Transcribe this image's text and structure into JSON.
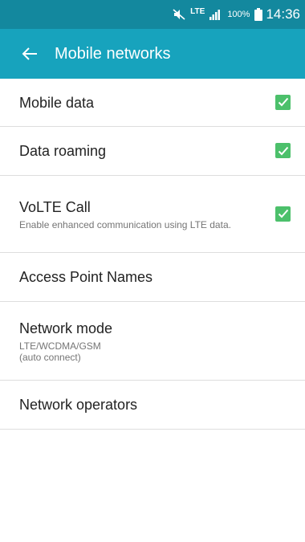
{
  "status_bar": {
    "icons": [
      "mute-icon",
      "lte-icon",
      "signal-icon",
      "battery-icon"
    ],
    "lte_label": "LTE",
    "battery_percent": "100%",
    "time": "14:36"
  },
  "app_bar": {
    "back_icon": "arrow-left-icon",
    "title": "Mobile networks"
  },
  "settings": {
    "mobile_data": {
      "label": "Mobile data",
      "checked": true
    },
    "data_roaming": {
      "label": "Data roaming",
      "checked": true
    },
    "volte": {
      "label": "VoLTE Call",
      "summary": "Enable enhanced communication using LTE data.",
      "checked": true
    },
    "apn": {
      "label": "Access Point Names"
    },
    "network_mode": {
      "label": "Network mode",
      "value_line1": "LTE/WCDMA/GSM",
      "value_line2": "(auto connect)"
    },
    "network_operators": {
      "label": "Network operators"
    }
  },
  "colors": {
    "status_bar": "#13889e",
    "app_bar": "#17a3bd",
    "checkbox": "#4cc06b",
    "divider": "#dedede"
  }
}
